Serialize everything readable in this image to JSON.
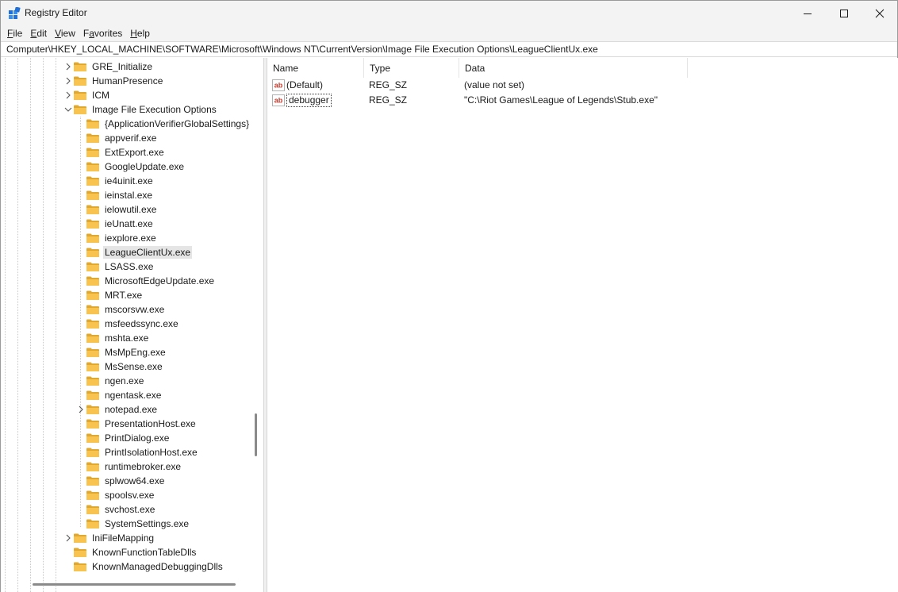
{
  "window": {
    "title": "Registry Editor",
    "controls": [
      "minimize",
      "maximize",
      "close"
    ]
  },
  "menu": {
    "file": {
      "acc": "F",
      "rest": "ile"
    },
    "edit": {
      "acc": "E",
      "rest": "dit"
    },
    "view": {
      "acc": "V",
      "rest": "iew"
    },
    "favorites": {
      "pre": "F",
      "acc": "a",
      "rest": "vorites"
    },
    "help": {
      "acc": "H",
      "rest": "elp"
    }
  },
  "address": "Computer\\HKEY_LOCAL_MACHINE\\SOFTWARE\\Microsoft\\Windows NT\\CurrentVersion\\Image File Execution Options\\LeagueClientUx.exe",
  "tree": [
    {
      "label": "GRE_Initialize",
      "level": 1,
      "chevron": "right"
    },
    {
      "label": "HumanPresence",
      "level": 1,
      "chevron": "right"
    },
    {
      "label": "ICM",
      "level": 1,
      "chevron": "right"
    },
    {
      "label": "Image File Execution Options",
      "level": 1,
      "chevron": "down"
    },
    {
      "label": "{ApplicationVerifierGlobalSettings}",
      "level": 2,
      "chevron": ""
    },
    {
      "label": "appverif.exe",
      "level": 2,
      "chevron": ""
    },
    {
      "label": "ExtExport.exe",
      "level": 2,
      "chevron": ""
    },
    {
      "label": "GoogleUpdate.exe",
      "level": 2,
      "chevron": ""
    },
    {
      "label": "ie4uinit.exe",
      "level": 2,
      "chevron": ""
    },
    {
      "label": "ieinstal.exe",
      "level": 2,
      "chevron": ""
    },
    {
      "label": "ielowutil.exe",
      "level": 2,
      "chevron": ""
    },
    {
      "label": "ieUnatt.exe",
      "level": 2,
      "chevron": ""
    },
    {
      "label": "iexplore.exe",
      "level": 2,
      "chevron": ""
    },
    {
      "label": "LeagueClientUx.exe",
      "level": 2,
      "chevron": "",
      "selected": true
    },
    {
      "label": "LSASS.exe",
      "level": 2,
      "chevron": ""
    },
    {
      "label": "MicrosoftEdgeUpdate.exe",
      "level": 2,
      "chevron": ""
    },
    {
      "label": "MRT.exe",
      "level": 2,
      "chevron": ""
    },
    {
      "label": "mscorsvw.exe",
      "level": 2,
      "chevron": ""
    },
    {
      "label": "msfeedssync.exe",
      "level": 2,
      "chevron": ""
    },
    {
      "label": "mshta.exe",
      "level": 2,
      "chevron": ""
    },
    {
      "label": "MsMpEng.exe",
      "level": 2,
      "chevron": ""
    },
    {
      "label": "MsSense.exe",
      "level": 2,
      "chevron": ""
    },
    {
      "label": "ngen.exe",
      "level": 2,
      "chevron": ""
    },
    {
      "label": "ngentask.exe",
      "level": 2,
      "chevron": ""
    },
    {
      "label": "notepad.exe",
      "level": 2,
      "chevron": "right"
    },
    {
      "label": "PresentationHost.exe",
      "level": 2,
      "chevron": ""
    },
    {
      "label": "PrintDialog.exe",
      "level": 2,
      "chevron": ""
    },
    {
      "label": "PrintIsolationHost.exe",
      "level": 2,
      "chevron": ""
    },
    {
      "label": "runtimebroker.exe",
      "level": 2,
      "chevron": ""
    },
    {
      "label": "splwow64.exe",
      "level": 2,
      "chevron": ""
    },
    {
      "label": "spoolsv.exe",
      "level": 2,
      "chevron": ""
    },
    {
      "label": "svchost.exe",
      "level": 2,
      "chevron": ""
    },
    {
      "label": "SystemSettings.exe",
      "level": 2,
      "chevron": ""
    },
    {
      "label": "IniFileMapping",
      "level": 1,
      "chevron": "right"
    },
    {
      "label": "KnownFunctionTableDlls",
      "level": 1,
      "chevron": ""
    },
    {
      "label": "KnownManagedDebuggingDlls",
      "level": 1,
      "chevron": ""
    }
  ],
  "list": {
    "columns": {
      "name": "Name",
      "type": "Type",
      "data": "Data"
    },
    "rows": [
      {
        "name": "(Default)",
        "type": "REG_SZ",
        "data": "(value not set)",
        "icon": "string-value-icon"
      },
      {
        "name": "debugger",
        "type": "REG_SZ",
        "data": "\"C:\\Riot Games\\League of Legends\\Stub.exe\"",
        "icon": "string-value-icon",
        "focused": true
      }
    ]
  },
  "colors": {
    "folder": "#f8c44f",
    "folder_dark": "#e0a82e",
    "selection": "#e5e5e5",
    "string_icon_red": "#c0392b"
  }
}
